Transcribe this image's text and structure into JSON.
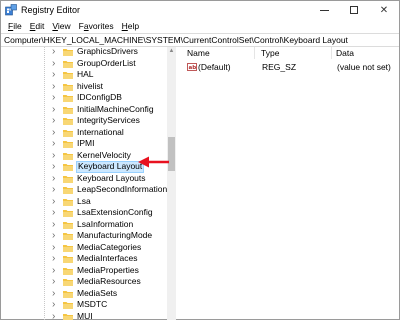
{
  "window": {
    "title": "Registry Editor",
    "icon": "registry-editor-icon"
  },
  "menubar": [
    {
      "pre": "",
      "u": "F",
      "post": "ile"
    },
    {
      "pre": "",
      "u": "E",
      "post": "dit"
    },
    {
      "pre": "",
      "u": "V",
      "post": "iew"
    },
    {
      "pre": "F",
      "u": "a",
      "post": "vorites"
    },
    {
      "pre": "",
      "u": "H",
      "post": "elp"
    }
  ],
  "address": "Computer\\HKEY_LOCAL_MACHINE\\SYSTEM\\CurrentControlSet\\Control\\Keyboard Layout",
  "tree": {
    "items": [
      {
        "label": "GraphicsDrivers"
      },
      {
        "label": "GroupOrderList"
      },
      {
        "label": "HAL"
      },
      {
        "label": "hivelist"
      },
      {
        "label": "IDConfigDB"
      },
      {
        "label": "InitialMachineConfig"
      },
      {
        "label": "IntegrityServices"
      },
      {
        "label": "International"
      },
      {
        "label": "IPMI"
      },
      {
        "label": "KernelVelocity"
      },
      {
        "label": "Keyboard Layout",
        "selected": true
      },
      {
        "label": "Keyboard Layouts"
      },
      {
        "label": "LeapSecondInformation"
      },
      {
        "label": "Lsa"
      },
      {
        "label": "LsaExtensionConfig"
      },
      {
        "label": "LsaInformation"
      },
      {
        "label": "ManufacturingMode"
      },
      {
        "label": "MediaCategories"
      },
      {
        "label": "MediaInterfaces"
      },
      {
        "label": "MediaProperties"
      },
      {
        "label": "MediaResources"
      },
      {
        "label": "MediaSets"
      },
      {
        "label": "MSDTC"
      },
      {
        "label": "MUI"
      }
    ]
  },
  "list": {
    "headers": {
      "name": "Name",
      "type": "Type",
      "data": "Data"
    },
    "rows": [
      {
        "name": "(Default)",
        "type": "REG_SZ",
        "data": "(value not set)"
      }
    ]
  },
  "colors": {
    "folder": "#f5c542",
    "selection_bg": "#cce8ff",
    "annotation_arrow": "#e8111f"
  }
}
